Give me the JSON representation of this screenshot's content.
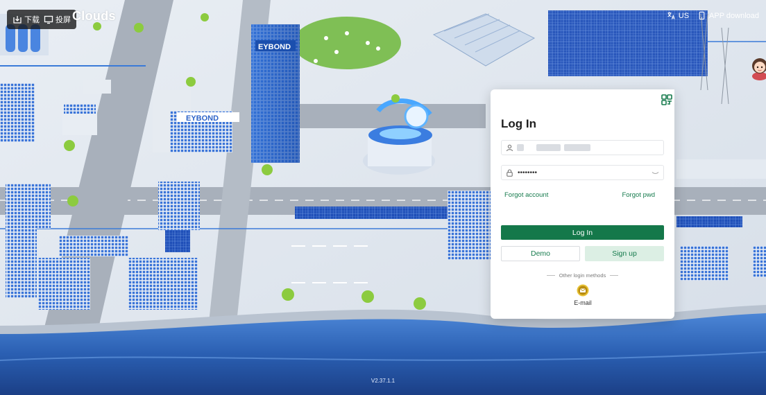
{
  "topbar": {
    "download_label": "下载",
    "screen_label": "投屏",
    "brand": "Clouds"
  },
  "top_right": {
    "language": "US",
    "app_download": "APP download"
  },
  "scene": {
    "building_sign_1": "EYBOND",
    "building_sign_2": "EYBOND"
  },
  "login": {
    "title": "Log In",
    "password_value": "••••••••",
    "forgot_account": "Forgot account",
    "forgot_pwd": "Forgot pwd",
    "login_button": "Log In",
    "demo_button": "Demo",
    "signup_button": "Sign up",
    "other_methods": "Other login methods",
    "email_label": "E-mail"
  },
  "version": "V2.37.1.1",
  "colors": {
    "primary_green": "#14784a",
    "light_green": "#dcefe4",
    "sea_blue": "#2d62b5",
    "ground": "#dfe6ee"
  },
  "icons": [
    "download-icon",
    "screen-cast-icon",
    "translate-icon",
    "phone-icon",
    "qr-code-icon",
    "user-icon",
    "lock-icon",
    "eye-icon",
    "email-icon"
  ]
}
